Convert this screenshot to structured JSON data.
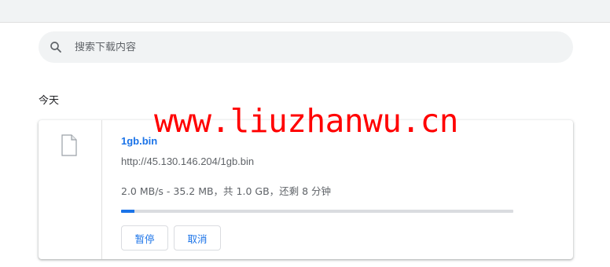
{
  "search": {
    "placeholder": "搜索下载内容"
  },
  "section": {
    "title": "今天"
  },
  "download": {
    "file_name": "1gb.bin",
    "url": "http://45.130.146.204/1gb.bin",
    "status": "2.0 MB/s - 35.2 MB，共 1.0 GB，还剩 8 分钟",
    "progress_fraction": 0.034,
    "pause_label": "暂停",
    "cancel_label": "取消"
  },
  "watermark": {
    "text": "www.liuzhanwu.cn"
  },
  "icons": {
    "search": "search-icon",
    "file": "file-icon"
  },
  "colors": {
    "accent": "#1a73e8",
    "watermark": "#ff0000"
  }
}
